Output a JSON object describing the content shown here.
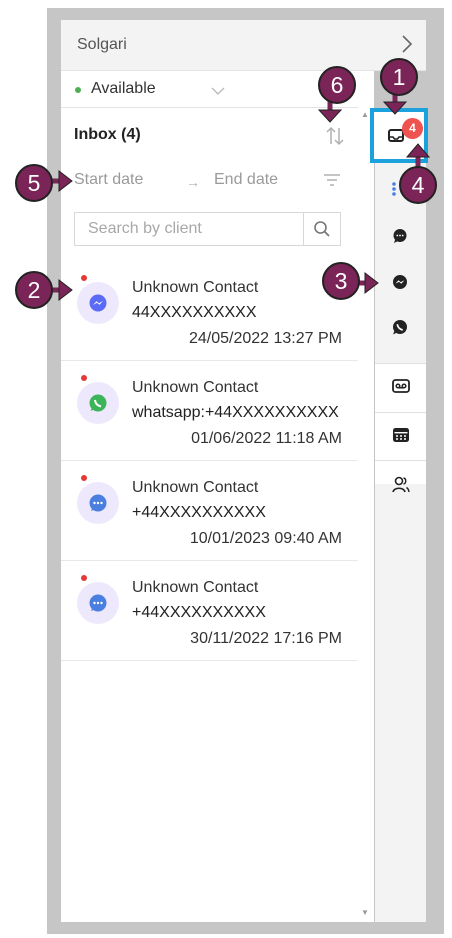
{
  "header": {
    "title": "Solgari"
  },
  "status": {
    "label": "Available"
  },
  "inbox": {
    "title": "Inbox (4)"
  },
  "filters": {
    "start_date": "Start date",
    "end_date": "End date"
  },
  "search": {
    "placeholder": "Search by client"
  },
  "conversations": [
    {
      "name": "Unknown Contact",
      "phone": "44XXXXXXXXXX",
      "time": "24/05/2022 13:27 PM",
      "channel": "messenger-icon"
    },
    {
      "name": "Unknown Contact",
      "phone": "whatsapp:+44XXXXXXXXXX",
      "time": "01/06/2022 11:18 AM",
      "channel": "whatsapp-icon"
    },
    {
      "name": "Unknown Contact",
      "phone": "+44XXXXXXXXXX",
      "time": "10/01/2023 09:40 AM",
      "channel": "chat-icon"
    },
    {
      "name": "Unknown Contact",
      "phone": "+44XXXXXXXXXX",
      "time": "30/11/2022 17:16 PM",
      "channel": "chat-icon"
    }
  ],
  "rail": {
    "inbox_badge": "4",
    "items": [
      "inbox-icon",
      "chat-icon",
      "messenger-icon",
      "whatsapp-icon",
      "voicemail-icon",
      "calendar-icon",
      "contacts-icon"
    ]
  },
  "callouts": [
    "1",
    "2",
    "3",
    "4",
    "5",
    "6"
  ],
  "colors": {
    "callout": "#7b2457",
    "highlight": "#1ba1dc",
    "badge": "#ef5350",
    "available": "#4caf50"
  }
}
